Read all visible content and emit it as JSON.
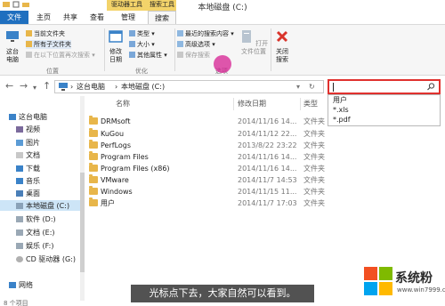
{
  "window": {
    "title": "本地磁盘 (C:)",
    "context_tab_groups": [
      "驱动器工具",
      "搜索工具"
    ]
  },
  "tabs": {
    "file": "文件",
    "home": "主页",
    "share": "共享",
    "view": "查看",
    "manage": "管理",
    "search": "搜索"
  },
  "ribbon": {
    "location": {
      "this_pc_btn": "这台\n电脑",
      "current_folder": "当前文件夹",
      "all_subfolders": "所有子文件夹",
      "search_again": "在以下位置再次搜索",
      "group_label": "位置"
    },
    "refine": {
      "modified_date": "修改\n日期",
      "kind": "类型",
      "size": "大小",
      "other_props": "其他属性",
      "group_label": "优化"
    },
    "options": {
      "recent_searches": "最近的搜索内容",
      "advanced_options": "高级选项",
      "save_search": "保存搜索",
      "open_location": "打开\n文件位置",
      "group_label": "选项"
    },
    "close": {
      "close_search": "关闭\n搜索"
    }
  },
  "address": {
    "crumbs": [
      "这台电脑",
      "本地磁盘 (C:)"
    ],
    "search_value": ""
  },
  "search_suggestions": [
    "用户",
    "*.xls",
    "*.pdf"
  ],
  "nav_pane": {
    "items": [
      "这台电脑",
      "视频",
      "图片",
      "文档",
      "下载",
      "音乐",
      "桌面",
      "本地磁盘 (C:)",
      "软件 (D:)",
      "文档 (E:)",
      "娱乐 (F:)",
      "CD 驱动器 (G:)",
      "网络"
    ],
    "item_count": "8 个项目"
  },
  "file_list": {
    "columns": [
      "名称",
      "修改日期",
      "类型"
    ],
    "rows": [
      {
        "name": "DRMsoft",
        "date": "2014/11/16 14...",
        "type": "文件夹"
      },
      {
        "name": "KuGou",
        "date": "2014/11/12 22...",
        "type": "文件夹"
      },
      {
        "name": "PerfLogs",
        "date": "2013/8/22 23:22",
        "type": "文件夹"
      },
      {
        "name": "Program Files",
        "date": "2014/11/16 14...",
        "type": "文件夹"
      },
      {
        "name": "Program Files (x86)",
        "date": "2014/11/16 14...",
        "type": "文件夹"
      },
      {
        "name": "VMware",
        "date": "2014/11/7 14:53",
        "type": "文件夹"
      },
      {
        "name": "Windows",
        "date": "2014/11/15 11...",
        "type": "文件夹"
      },
      {
        "name": "用户",
        "date": "2014/11/7 17:03",
        "type": "文件夹"
      }
    ]
  },
  "overlay": {
    "caption": "光标点下去，大家自然可以看到。",
    "watermark_text": "系统粉",
    "watermark_url": "www.win7999.com"
  },
  "colors": {
    "file_tab": "#1f6fbf",
    "context_group": "#f3d36a",
    "search_highlight": "#e0312e",
    "folder": "#e8b64a",
    "selection": "#cde5f7",
    "cursor_marker": "#d72896"
  },
  "icons": [
    "save-icon",
    "undo-icon",
    "folder-icon",
    "search-icon",
    "refresh-icon",
    "close-x-icon",
    "computer-icon",
    "drive-icon",
    "network-icon",
    "windows-logo-icon"
  ]
}
